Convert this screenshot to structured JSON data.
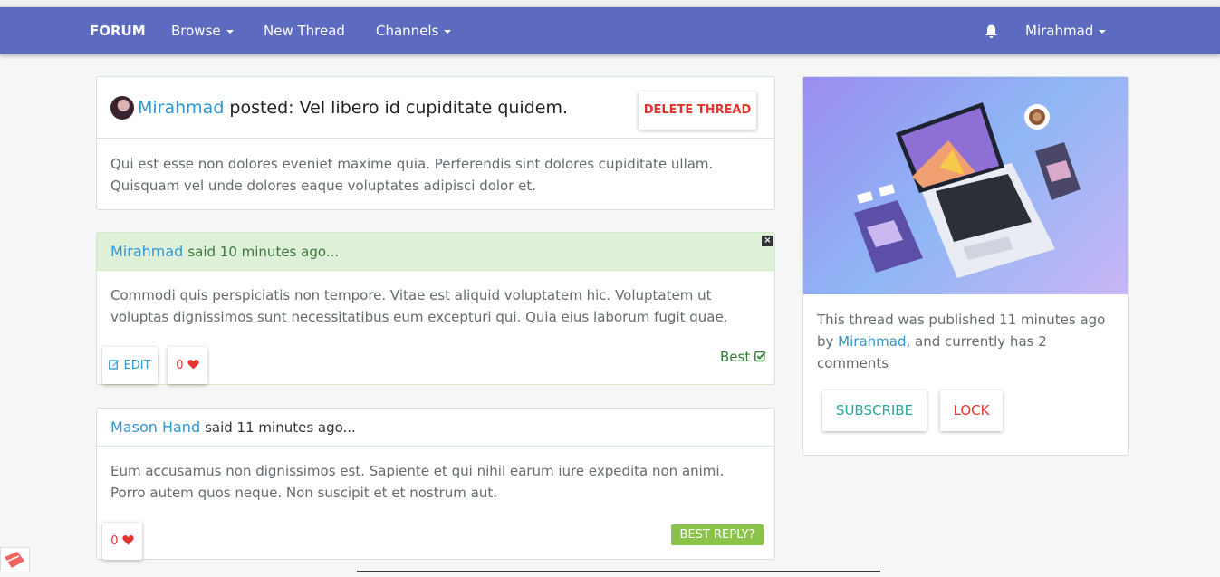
{
  "navbar": {
    "brand": "FORUM",
    "browse": "Browse",
    "new_thread": "New Thread",
    "channels": "Channels",
    "user": "Mirahmad"
  },
  "thread": {
    "author": "Mirahmad",
    "posted_text": "posted: Vel libero id cupiditate quidem.",
    "delete_label": "DELETE THREAD",
    "body": "Qui est esse non dolores eveniet maxime quia. Perferendis sint dolores cupiditate ullam. Quisquam vel unde dolores eaque voluptates adipisci dolor et."
  },
  "replies": [
    {
      "author": "Mirahmad",
      "said": "said 10 minutes ago...",
      "body": "Commodi quis perspiciatis non tempore. Vitae est aliquid voluptatem hic. Voluptatem ut voluptas dignissimos sunt necessitatibus eum excepturi qui. Quia eius laborum fugit quae.",
      "edit_label": "EDIT",
      "favorites": "0",
      "best_label": "Best",
      "is_best": true
    },
    {
      "author": "Mason Hand",
      "said": "said 11 minutes ago...",
      "body": "Eum accusamus non dignissimos est. Sapiente et qui nihil earum iure expedita non animi. Porro autem quos neque. Non suscipit et et nostrum aut.",
      "favorites": "0",
      "best_reply_label": "BEST REPLY?"
    }
  ],
  "sidebar": {
    "text_before": "This thread was published 11 minutes ago by ",
    "author": "Mirahmad",
    "text_after": ", and currently has 2 comments",
    "subscribe_label": "SUBSCRIBE",
    "lock_label": "LOCK"
  },
  "colors": {
    "navbar": "#5c6bc0",
    "link": "#3097d1",
    "danger": "#e3342f",
    "success_bg": "#dff0d8",
    "best_reply": "#8bc34a",
    "subscribe": "#26a69a"
  },
  "icons": {
    "bell": "bell-icon",
    "heart": "heart-icon",
    "edit": "edit-icon",
    "check": "check-square-icon",
    "close": "close-icon"
  }
}
